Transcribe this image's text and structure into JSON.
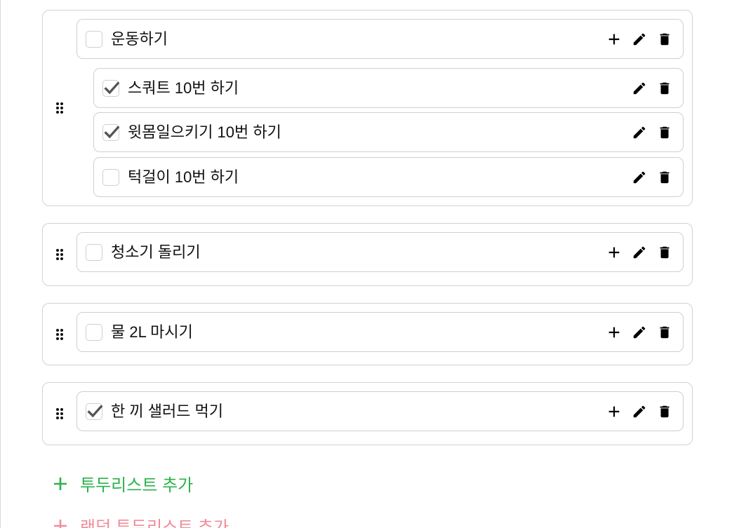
{
  "colors": {
    "add_todo": "#2ab24a",
    "random_todo": "#f08c98",
    "checkmark": "#545454"
  },
  "icons": {
    "drag": "drag-handle-icon",
    "add": "plus-icon",
    "edit": "pencil-icon",
    "delete": "trash-icon",
    "check": "checkmark-icon"
  },
  "todos": [
    {
      "label": "운동하기",
      "checked": false,
      "subtasks": [
        {
          "label": "스쿼트 10번 하기",
          "checked": true
        },
        {
          "label": "윗몸일으키기 10번 하기",
          "checked": true
        },
        {
          "label": "턱걸이 10번 하기",
          "checked": false
        }
      ]
    },
    {
      "label": "청소기 돌리기",
      "checked": false,
      "subtasks": []
    },
    {
      "label": "물 2L 마시기",
      "checked": false,
      "subtasks": []
    },
    {
      "label": "한 끼 샐러드 먹기",
      "checked": true,
      "subtasks": []
    }
  ],
  "footer": {
    "add_todo_label": "투두리스트 추가",
    "add_random_label": "랜덤 투두리스트 추가"
  }
}
